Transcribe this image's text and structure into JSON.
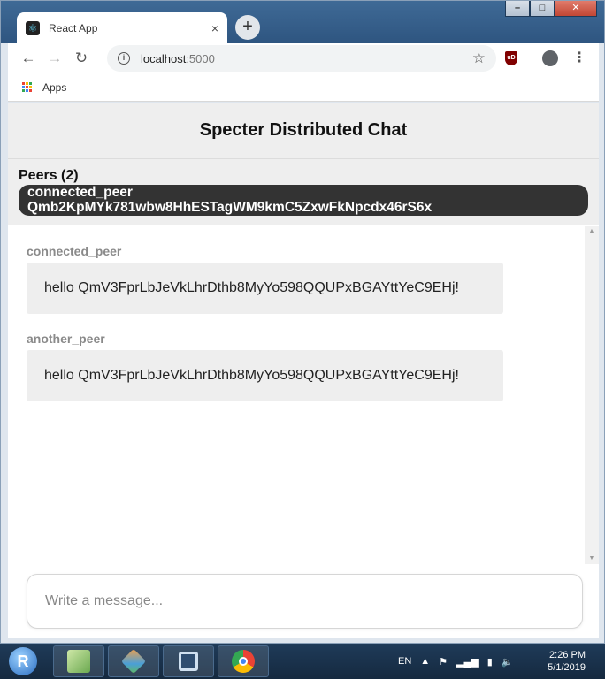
{
  "browser": {
    "tab_title": "React App",
    "tab_close": "×",
    "new_tab": "+",
    "url_host": "localhost",
    "url_port": ":5000",
    "bookmarks_apps": "Apps",
    "ublock_label": "uD"
  },
  "app": {
    "title": "Specter Distributed Chat",
    "peers_title": "Peers (2)",
    "peer": {
      "name": "connected_peer",
      "id": "Qmb2KpMYk781wbw8HhESTagWM9kmC5ZxwFkNpcdx46rS6x"
    },
    "messages": [
      {
        "sender": "connected_peer",
        "text": "hello QmV3FprLbJeVkLhrDthb8MyYo598QQUPxBGAYttYeC9EHj!"
      },
      {
        "sender": "another_peer",
        "text": "hello QmV3FprLbJeVkLhrDthb8MyYo598QQUPxBGAYttYeC9EHj!"
      }
    ],
    "composer_placeholder": "Write a message..."
  },
  "taskbar": {
    "language": "EN",
    "time": "2:26 PM",
    "date": "5/1/2019"
  },
  "colors": {
    "peer_pill": "#333333",
    "panel_bg": "#eeeeee",
    "sender_text": "#8a8a8a"
  }
}
